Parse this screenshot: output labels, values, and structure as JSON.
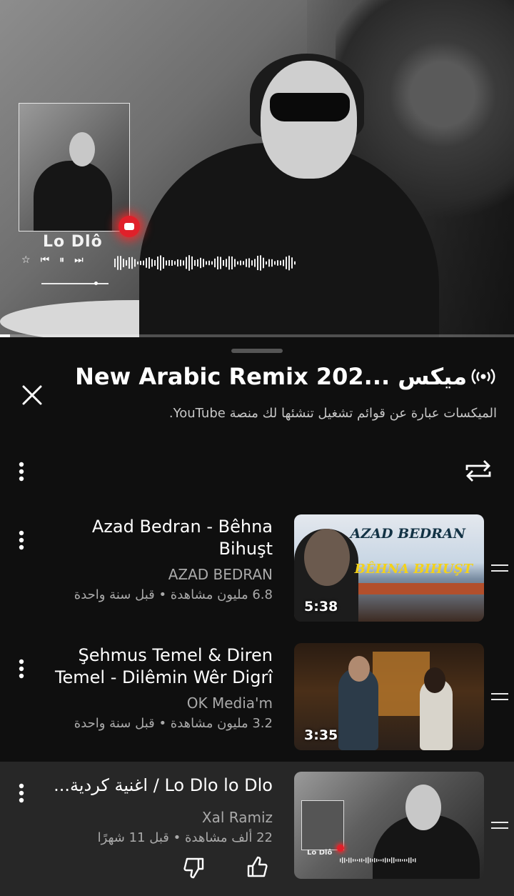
{
  "player": {
    "song_title": "Lo Dlô",
    "progress": 0.02
  },
  "playlist": {
    "title": "New Arabic Remix 202... ميكس",
    "description": "الميكسات عبارة عن قوائم تشغيل تنشئها لك منصة YouTube."
  },
  "videos": [
    {
      "title": "Azad Bedran - Bêhna Bihuşt",
      "channel": "AZAD BEDRAN",
      "meta": "6.8 مليون مشاهدة • قبل سنة واحدة",
      "duration": "5:38",
      "thumb_text_1": "AZAD BEDRAN",
      "thumb_text_2": "BÊHNA BIHUŞT"
    },
    {
      "title": "Şehmus Temel & Diren Temel - Dilêmin Wêr Digrî",
      "channel": "OK Media'm",
      "meta": "3.2 مليون مشاهدة • قبل سنة واحدة",
      "duration": "3:35"
    },
    {
      "title": "Lo Dlo lo Dlo / اغنية كردية...",
      "channel": "Xal Ramiz",
      "meta": "22 ألف مشاهدة • قبل 11 شهرًا",
      "thumb_label": "Lo Dlô"
    }
  ],
  "icons": {
    "close": "close-icon",
    "mix": "mix-broadcast-icon",
    "loop": "loop-icon",
    "more": "more-vertical-icon",
    "drag": "drag-handle-icon",
    "like": "thumbs-up-icon",
    "dislike": "thumbs-down-icon"
  },
  "colors": {
    "background": "#0f0f0f",
    "active_row": "#272727",
    "secondary_text": "#aaaaaa",
    "youtube_red": "#e0202a"
  }
}
